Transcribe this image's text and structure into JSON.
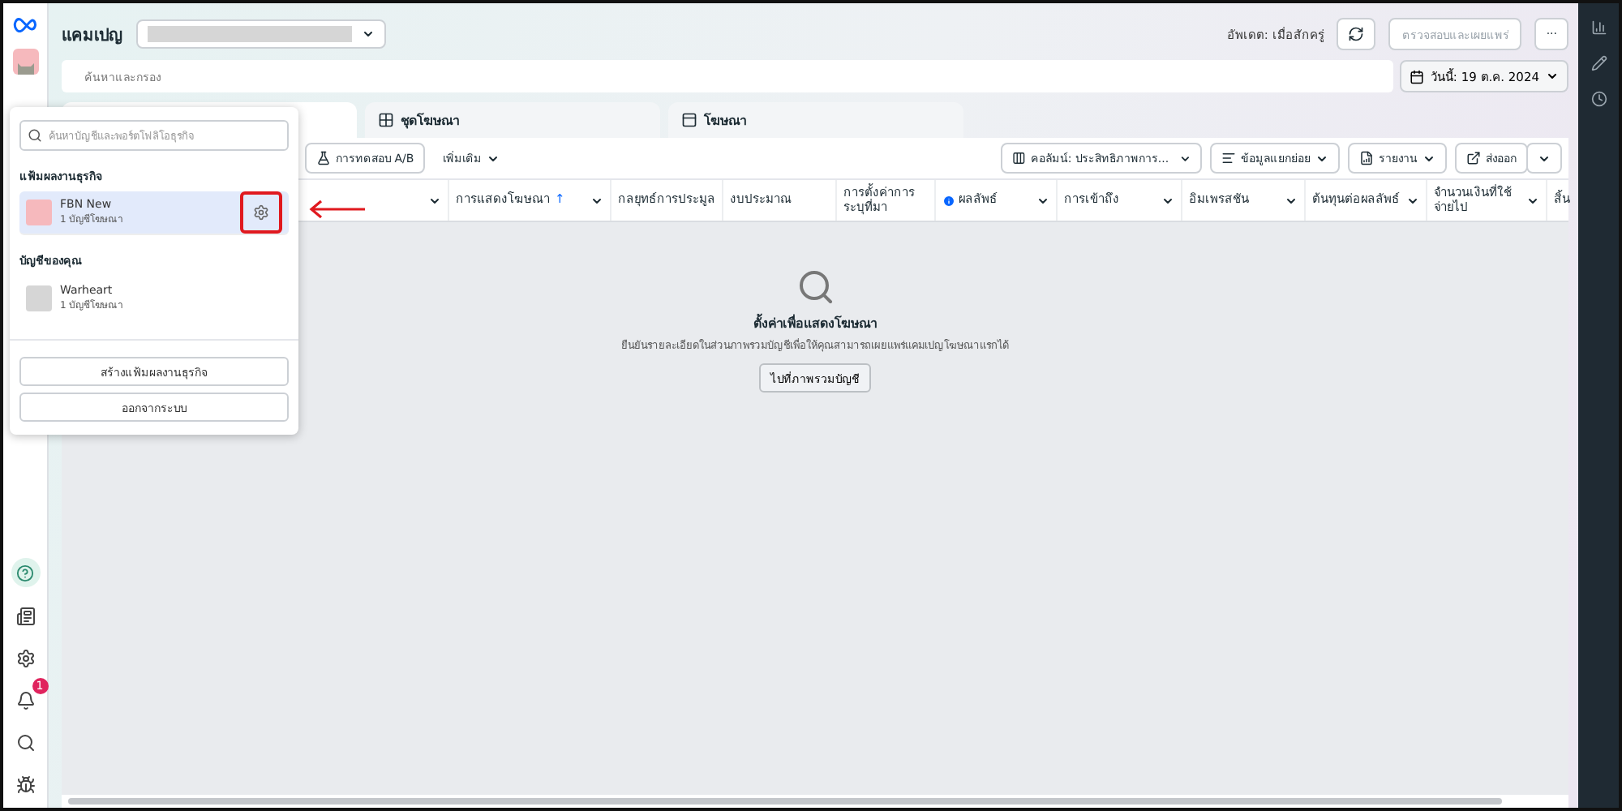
{
  "header": {
    "title": "แคมเปญ",
    "updated": "อัพเดต: เมื่อสักครู่",
    "publish_button": {
      "label": "ตรวจสอบและเผยแพร่",
      "disabled": true
    },
    "more_button": "···"
  },
  "search": {
    "placeholder": "ค้นหาและกรอง"
  },
  "date_button": "วันนี้: 19 ต.ค. 2024",
  "tabs": [
    {
      "selected": true
    },
    {
      "label": "ชุดโฆษณา",
      "selected": false
    },
    {
      "label": "โฆษณา",
      "selected": false
    }
  ],
  "toolbar": {
    "left": [
      "การทดสอบ A/B",
      "เพิ่มเติม"
    ],
    "columns_button": "คอลัมน์: ประสิทธิภาพการ...",
    "breakdown_button": "ข้อมูลแยกย่อย",
    "reports_button": "รายงาน",
    "export_button": "ส่งออก"
  },
  "table": {
    "columns": [
      {
        "menu": true
      },
      {
        "label": "การแสดงโฆษณา",
        "sort": "↑",
        "menu": true
      },
      {
        "label": "กลยุทธ์การประมูล",
        "menu": false
      },
      {
        "label": "งบประมาณ",
        "menu": false
      },
      {
        "label": "การตั้งค่าการระบุที่มา",
        "menu": false
      },
      {
        "label": "ผลลัพธ์",
        "info": true,
        "menu": true
      },
      {
        "label": "การเข้าถึง",
        "menu": true
      },
      {
        "label": "อิมเพรสชัน",
        "menu": true
      },
      {
        "label": "ต้นทุนต่อผลลัพธ์",
        "menu": true
      },
      {
        "label": "จำนวนเงินที่ใช้จ่ายไป",
        "menu": true
      },
      {
        "label": "สิ้น"
      }
    ]
  },
  "empty_state": {
    "title": "ตั้งค่าเพื่อแสดงโฆษณา",
    "message": "ยืนยันรายละเอียดในส่วนภาพรวมบัญชีเพื่อให้คุณสามารถเผยแพร่แคมเปญโฆษณาแรกได้",
    "button": "ไปที่ภาพรวมบัญชี"
  },
  "account_menu": {
    "search_placeholder": "ค้นหาบัญชีและพอร์ตโฟลิโอธุรกิจ",
    "sections": [
      {
        "title": "แฟ้มผลงานธุรกิจ",
        "items": [
          {
            "name": "FBN New",
            "detail": "1 บัญชีโฆษณา",
            "selected": true,
            "highlighted": true
          }
        ]
      },
      {
        "title": "บัญชีของคุณ",
        "items": [
          {
            "name": "Warheart",
            "detail": "1 บัญชีโฆษณา",
            "selected": false,
            "highlighted": false
          }
        ]
      }
    ],
    "buttons": [
      "สร้างแฟ้มผลงานธุรกิจ",
      "ออกจากระบบ"
    ]
  },
  "notifications": {
    "badge": "1"
  }
}
